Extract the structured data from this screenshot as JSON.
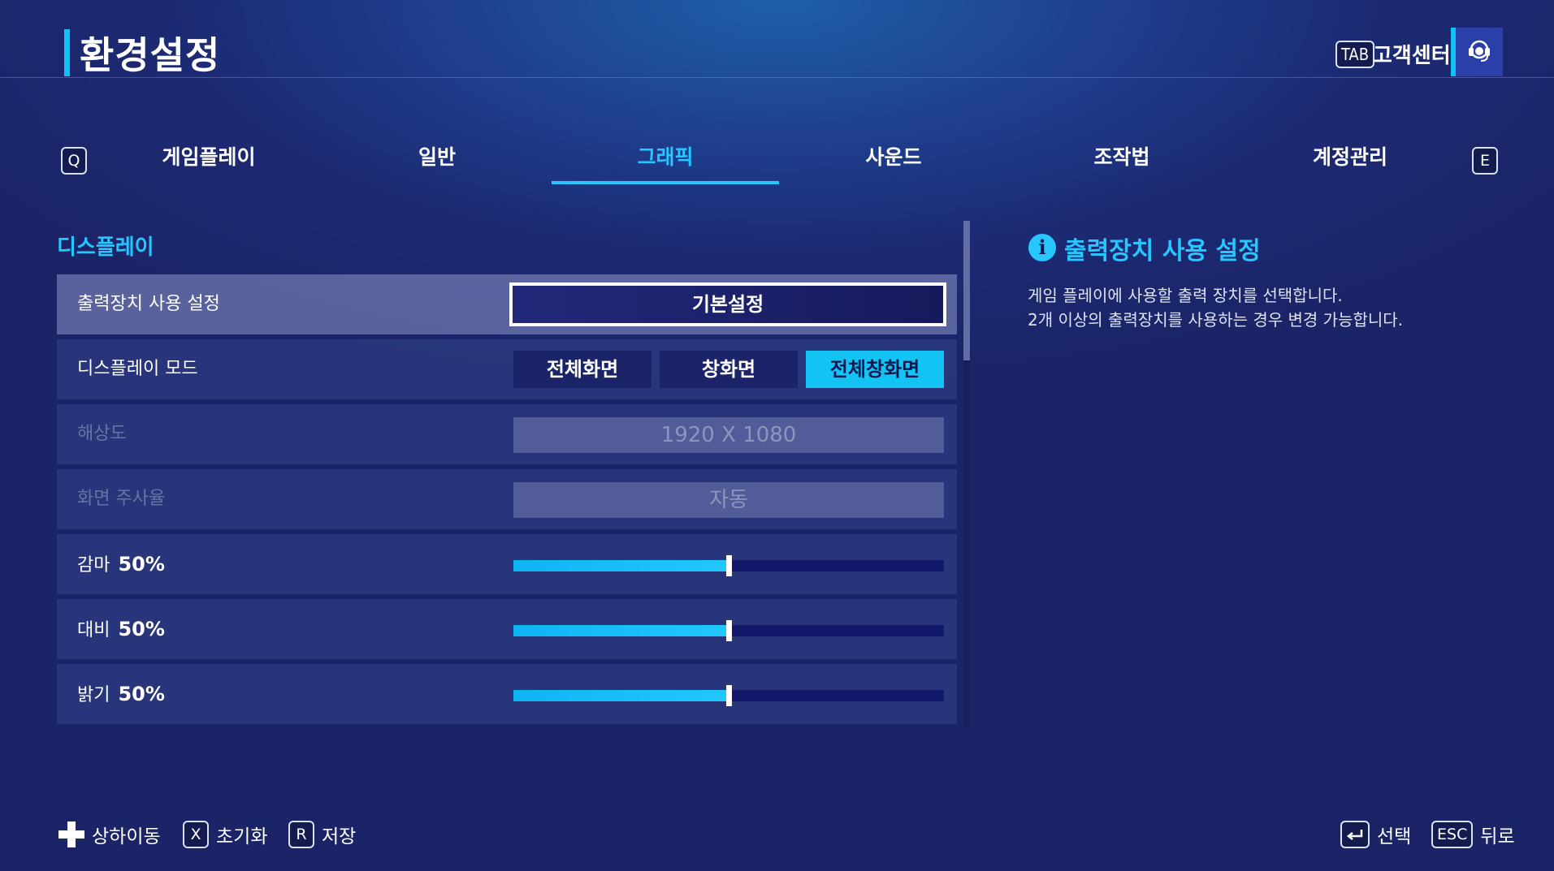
{
  "header": {
    "title": "환경설정",
    "support_key": "TAB",
    "support_label": "고객센터"
  },
  "tabs": {
    "prev_key": "Q",
    "next_key": "E",
    "items": [
      {
        "label": "게임플레이"
      },
      {
        "label": "일반"
      },
      {
        "label": "그래픽",
        "active": true
      },
      {
        "label": "사운드"
      },
      {
        "label": "조작법"
      },
      {
        "label": "계정관리"
      }
    ]
  },
  "section": {
    "title": "디스플레이"
  },
  "settings": {
    "output_device": {
      "label": "출력장치 사용 설정",
      "value": "기본설정"
    },
    "display_mode": {
      "label": "디스플레이 모드",
      "options": [
        "전체화면",
        "창화면",
        "전체창화면"
      ],
      "selected": "전체창화면"
    },
    "resolution": {
      "label": "해상도",
      "value": "1920 X 1080"
    },
    "refresh_rate": {
      "label": "화면 주사율",
      "value": "자동"
    },
    "gamma": {
      "label": "감마",
      "value_text": "50%",
      "value": 0.5
    },
    "contrast": {
      "label": "대비",
      "value_text": "50%",
      "value": 0.5
    },
    "brightness": {
      "label": "밝기",
      "value_text": "50%",
      "value": 0.5
    }
  },
  "info": {
    "title": "출력장치 사용 설정",
    "lines": [
      "게임 플레이에 사용할 출력 장치를 선택합니다.",
      "2개 이상의 출력장치를 사용하는 경우 변경 가능합니다."
    ]
  },
  "footer": {
    "move_label": "상하이동",
    "reset_key": "X",
    "reset_label": "초기화",
    "save_key": "R",
    "save_label": "저장",
    "select_label": "선택",
    "back_key": "ESC",
    "back_label": "뒤로"
  },
  "colors": {
    "accent": "#27c6ff",
    "selected_option": "#12c3f4",
    "background": "#1c2a73"
  }
}
